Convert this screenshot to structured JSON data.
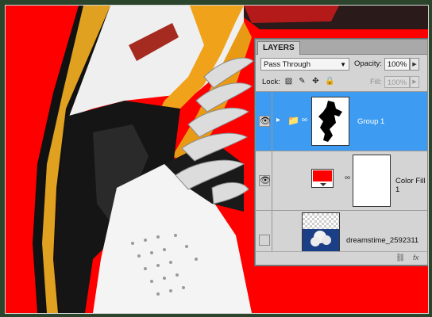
{
  "panel": {
    "tab_label": "LAYERS",
    "blend_mode": "Pass Through",
    "opacity_label": "Opacity:",
    "opacity_value": "100%",
    "lock_label": "Lock:",
    "fill_label": "Fill:",
    "fill_value": "100%"
  },
  "layers": [
    {
      "name": "Group 1",
      "selected": true,
      "visible": true,
      "type": "group"
    },
    {
      "name": "Color Fill 1",
      "selected": false,
      "visible": true,
      "type": "fill",
      "fill_color": "#ff0000"
    },
    {
      "name": "dreamstime_2592311",
      "selected": false,
      "visible": false,
      "type": "image"
    }
  ],
  "footer": {
    "link_icon": "link-icon",
    "fx_label": "fx"
  },
  "colors": {
    "canvas_bg": "#ff0000",
    "selection": "#3d9bf1",
    "frame": "#2a452c"
  }
}
